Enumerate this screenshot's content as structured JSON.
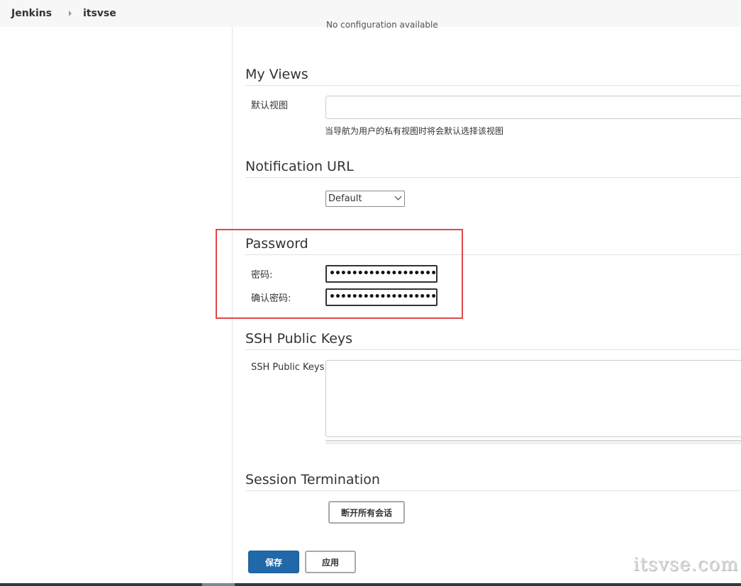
{
  "breadcrumb": {
    "items": [
      "Jenkins",
      "itsvse"
    ]
  },
  "cut_text": "No configuration available",
  "my_views": {
    "title": "My Views",
    "label": "默认视图",
    "value": "",
    "help": "当导航为用户的私有视图时将会默认选择该视图"
  },
  "notification": {
    "title": "Notification URL",
    "selected": "Default"
  },
  "password": {
    "title": "Password",
    "password_label": "密码:",
    "confirm_label": "确认密码:",
    "password_mask": "••••••••••••••••••••••••••••••",
    "confirm_mask": "••••••••••••••••••••••••••••••"
  },
  "ssh": {
    "title": "SSH Public Keys",
    "label": "SSH Public Keys",
    "value": ""
  },
  "session": {
    "title": "Session Termination",
    "button": "断开所有会话"
  },
  "actions": {
    "save": "保存",
    "apply": "应用"
  },
  "watermark": "itsvse.com",
  "colors": {
    "primary": "#2068a9",
    "highlight": "#e04848"
  }
}
